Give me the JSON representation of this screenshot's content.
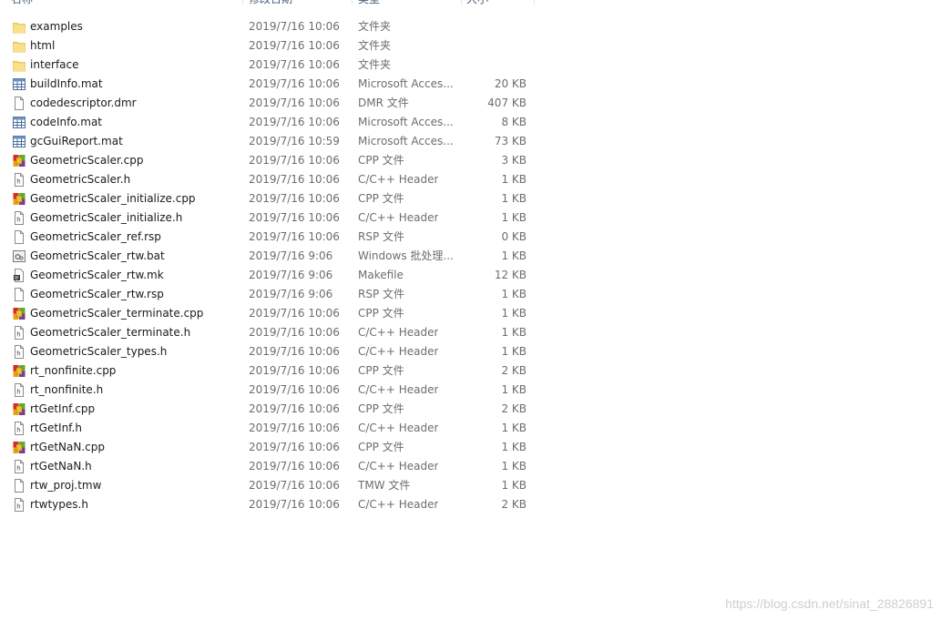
{
  "header": {
    "name": "名称",
    "date": "修改日期",
    "type": "类型",
    "size": "大小"
  },
  "files": [
    {
      "name": "examples",
      "date": "2019/7/16 10:06",
      "type": "文件夹",
      "size": "",
      "icon": "folder-icon"
    },
    {
      "name": "html",
      "date": "2019/7/16 10:06",
      "type": "文件夹",
      "size": "",
      "icon": "folder-icon"
    },
    {
      "name": "interface",
      "date": "2019/7/16 10:06",
      "type": "文件夹",
      "size": "",
      "icon": "folder-icon"
    },
    {
      "name": "buildInfo.mat",
      "date": "2019/7/16 10:06",
      "type": "Microsoft Acces...",
      "size": "20 KB",
      "icon": "table-file-icon"
    },
    {
      "name": "codedescriptor.dmr",
      "date": "2019/7/16 10:06",
      "type": "DMR 文件",
      "size": "407 KB",
      "icon": "blank-file-icon"
    },
    {
      "name": "codeInfo.mat",
      "date": "2019/7/16 10:06",
      "type": "Microsoft Acces...",
      "size": "8 KB",
      "icon": "table-file-icon"
    },
    {
      "name": "gcGuiReport.mat",
      "date": "2019/7/16 10:59",
      "type": "Microsoft Acces...",
      "size": "73 KB",
      "icon": "table-file-icon"
    },
    {
      "name": "GeometricScaler.cpp",
      "date": "2019/7/16 10:06",
      "type": "CPP 文件",
      "size": "3 KB",
      "icon": "cpp-file-icon"
    },
    {
      "name": "GeometricScaler.h",
      "date": "2019/7/16 10:06",
      "type": "C/C++ Header",
      "size": "1 KB",
      "icon": "header-file-icon"
    },
    {
      "name": "GeometricScaler_initialize.cpp",
      "date": "2019/7/16 10:06",
      "type": "CPP 文件",
      "size": "1 KB",
      "icon": "cpp-file-icon"
    },
    {
      "name": "GeometricScaler_initialize.h",
      "date": "2019/7/16 10:06",
      "type": "C/C++ Header",
      "size": "1 KB",
      "icon": "header-file-icon"
    },
    {
      "name": "GeometricScaler_ref.rsp",
      "date": "2019/7/16 10:06",
      "type": "RSP 文件",
      "size": "0 KB",
      "icon": "blank-file-icon"
    },
    {
      "name": "GeometricScaler_rtw.bat",
      "date": "2019/7/16 9:06",
      "type": "Windows 批处理...",
      "size": "1 KB",
      "icon": "batch-file-icon"
    },
    {
      "name": "GeometricScaler_rtw.mk",
      "date": "2019/7/16 9:06",
      "type": "Makefile",
      "size": "12 KB",
      "icon": "makefile-icon"
    },
    {
      "name": "GeometricScaler_rtw.rsp",
      "date": "2019/7/16 9:06",
      "type": "RSP 文件",
      "size": "1 KB",
      "icon": "blank-file-icon"
    },
    {
      "name": "GeometricScaler_terminate.cpp",
      "date": "2019/7/16 10:06",
      "type": "CPP 文件",
      "size": "1 KB",
      "icon": "cpp-file-icon"
    },
    {
      "name": "GeometricScaler_terminate.h",
      "date": "2019/7/16 10:06",
      "type": "C/C++ Header",
      "size": "1 KB",
      "icon": "header-file-icon"
    },
    {
      "name": "GeometricScaler_types.h",
      "date": "2019/7/16 10:06",
      "type": "C/C++ Header",
      "size": "1 KB",
      "icon": "header-file-icon"
    },
    {
      "name": "rt_nonfinite.cpp",
      "date": "2019/7/16 10:06",
      "type": "CPP 文件",
      "size": "2 KB",
      "icon": "cpp-file-icon"
    },
    {
      "name": "rt_nonfinite.h",
      "date": "2019/7/16 10:06",
      "type": "C/C++ Header",
      "size": "1 KB",
      "icon": "header-file-icon"
    },
    {
      "name": "rtGetInf.cpp",
      "date": "2019/7/16 10:06",
      "type": "CPP 文件",
      "size": "2 KB",
      "icon": "cpp-file-icon"
    },
    {
      "name": "rtGetInf.h",
      "date": "2019/7/16 10:06",
      "type": "C/C++ Header",
      "size": "1 KB",
      "icon": "header-file-icon"
    },
    {
      "name": "rtGetNaN.cpp",
      "date": "2019/7/16 10:06",
      "type": "CPP 文件",
      "size": "1 KB",
      "icon": "cpp-file-icon"
    },
    {
      "name": "rtGetNaN.h",
      "date": "2019/7/16 10:06",
      "type": "C/C++ Header",
      "size": "1 KB",
      "icon": "header-file-icon"
    },
    {
      "name": "rtw_proj.tmw",
      "date": "2019/7/16 10:06",
      "type": "TMW 文件",
      "size": "1 KB",
      "icon": "blank-file-icon"
    },
    {
      "name": "rtwtypes.h",
      "date": "2019/7/16 10:06",
      "type": "C/C++ Header",
      "size": "2 KB",
      "icon": "header-file-icon"
    }
  ],
  "watermark": "https://blog.csdn.net/sinat_28826891"
}
